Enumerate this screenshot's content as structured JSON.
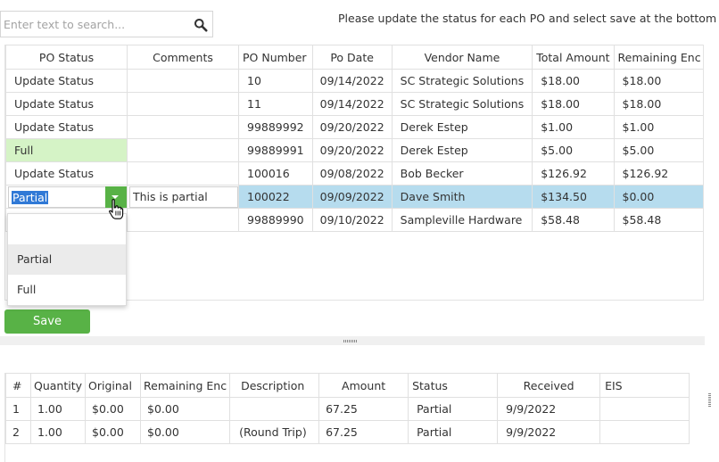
{
  "search": {
    "placeholder": "Enter text to search..."
  },
  "instructions": "Please update the status for each PO and select save at the bottom",
  "po_grid": {
    "headers": [
      "PO Status",
      "Comments",
      "PO Number",
      "Po Date",
      "Vendor Name",
      "Total Amount",
      "Remaining Enc"
    ],
    "rows": [
      {
        "status": "Update Status",
        "comments": "",
        "po_number": "10",
        "po_date": "09/14/2022",
        "vendor": "SC Strategic Solutions",
        "total": "$18.00",
        "remaining": "$18.00"
      },
      {
        "status": "Update Status",
        "comments": "",
        "po_number": "11",
        "po_date": "09/14/2022",
        "vendor": "SC Strategic Solutions",
        "total": "$18.00",
        "remaining": "$18.00"
      },
      {
        "status": "Update Status",
        "comments": "",
        "po_number": "99889992",
        "po_date": "09/20/2022",
        "vendor": "Derek Estep",
        "total": "$1.00",
        "remaining": "$1.00"
      },
      {
        "status": "Full",
        "comments": "",
        "po_number": "99889991",
        "po_date": "09/20/2022",
        "vendor": "Derek Estep",
        "total": "$5.00",
        "remaining": "$5.00"
      },
      {
        "status": "Update Status",
        "comments": "",
        "po_number": "100016",
        "po_date": "09/08/2022",
        "vendor": "Bob Becker",
        "total": "$126.92",
        "remaining": "$126.92"
      },
      {
        "status": "Partial",
        "comments": "This is partial",
        "po_number": "100022",
        "po_date": "09/09/2022",
        "vendor": "Dave Smith",
        "total": "$134.50",
        "remaining": "$0.00"
      },
      {
        "status": "",
        "comments": "",
        "po_number": "99889990",
        "po_date": "09/10/2022",
        "vendor": "Sampleville Hardware",
        "total": "$58.48",
        "remaining": "$58.48"
      }
    ]
  },
  "status_dropdown": {
    "options": [
      "",
      "Partial",
      "Full"
    ],
    "highlighted": "Partial"
  },
  "save_label": "Save",
  "detail_grid": {
    "headers": [
      "#",
      "Quantity",
      "Original",
      "Remaining Enc",
      "Description",
      "Amount",
      "Status",
      "Received",
      "EIS"
    ],
    "rows": [
      {
        "num": "1",
        "quantity": "1.00",
        "original": "$0.00",
        "remaining": "$0.00",
        "description": "",
        "amount": "67.25",
        "status": "Partial",
        "received": "9/9/2022",
        "eis": ""
      },
      {
        "num": "2",
        "quantity": "1.00",
        "original": "$0.00",
        "remaining": "$0.00",
        "description": "(Round Trip)",
        "amount": "67.25",
        "status": "Partial",
        "received": "9/9/2022",
        "eis": ""
      }
    ]
  },
  "colors": {
    "accent_green": "#58b246",
    "selected_row": "#b6dcee",
    "full_status": "#d5f3c6",
    "text_selection": "#3079d6"
  }
}
